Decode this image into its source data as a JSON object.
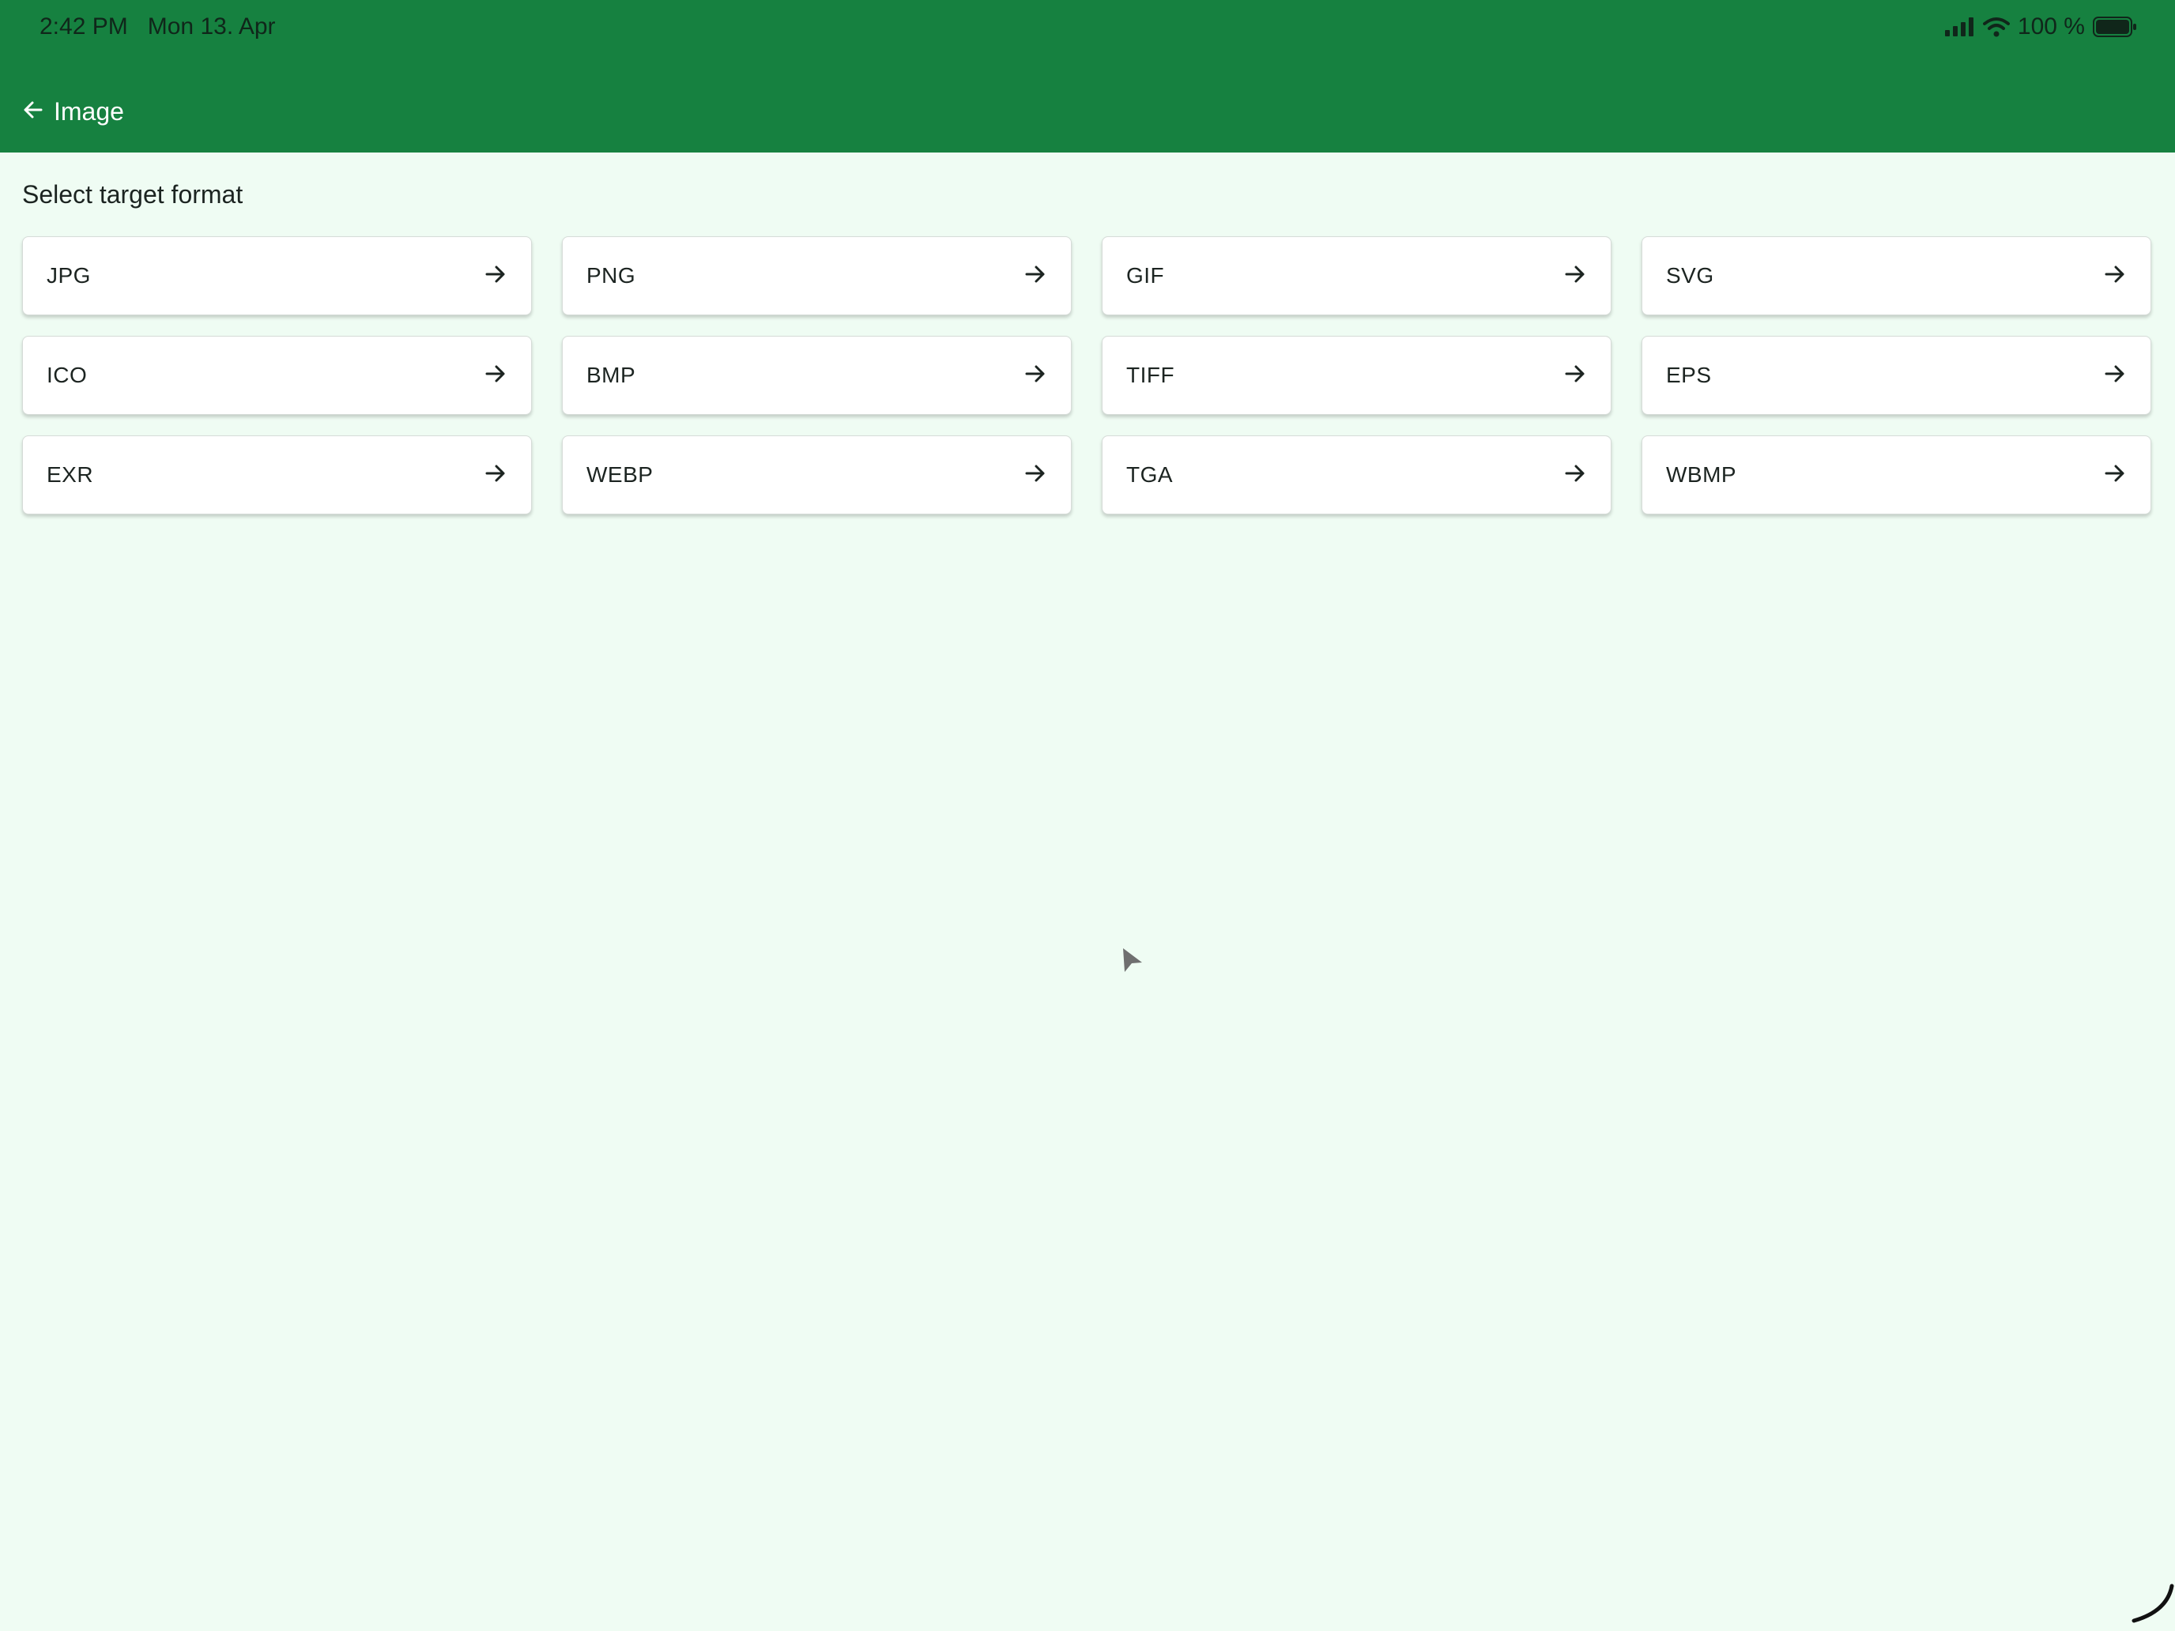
{
  "status_bar": {
    "time": "2:42 PM",
    "date": "Mon 13. Apr",
    "battery": "100 %",
    "icons": [
      "signal-icon",
      "wifi-icon",
      "battery-icon"
    ]
  },
  "header": {
    "back_icon": "arrow-left-icon",
    "title": "Image",
    "color": "#168140"
  },
  "main": {
    "section_title": "Select target format",
    "background": "#effcf3",
    "formats": [
      {
        "label": "JPG"
      },
      {
        "label": "PNG"
      },
      {
        "label": "GIF"
      },
      {
        "label": "SVG"
      },
      {
        "label": "ICO"
      },
      {
        "label": "BMP"
      },
      {
        "label": "TIFF"
      },
      {
        "label": "EPS"
      },
      {
        "label": "EXR"
      },
      {
        "label": "WEBP"
      },
      {
        "label": "TGA"
      },
      {
        "label": "WBMP"
      }
    ],
    "card_icon": "arrow-right-icon"
  }
}
